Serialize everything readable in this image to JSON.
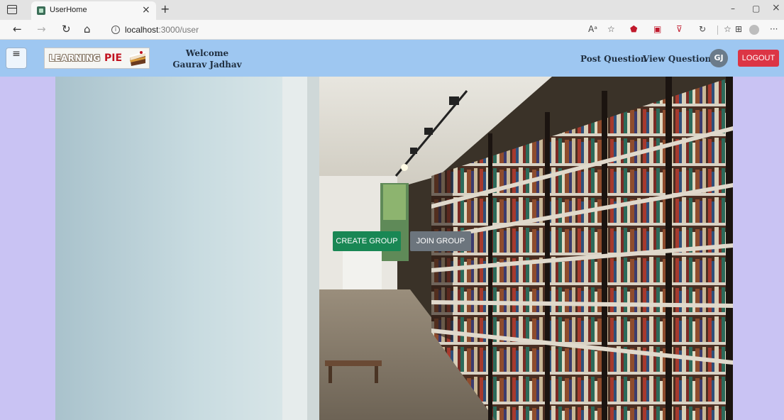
{
  "browser": {
    "tab_title": "UserHome",
    "tab_close": "×",
    "new_tab": "+",
    "url_host": "localhost",
    "url_path": ":3000/user",
    "window_controls": {
      "minimize": "–",
      "restore": "▢",
      "close": "×"
    },
    "nav": {
      "back": "←",
      "forward": "→",
      "reload": "↻",
      "home": "⌂",
      "info": "i"
    },
    "toolbar_icons": [
      "read-aloud-icon",
      "favorite-icon",
      "shield-extension-icon",
      "video-extension-icon",
      "pocket-extension-icon",
      "extensions-icon",
      "favorites-bar-icon",
      "collections-icon",
      "profile-icon",
      "more-icon"
    ]
  },
  "navbar": {
    "menu_icon": "≡",
    "logo": {
      "learning": "LEARNING",
      "pie": "PIE"
    },
    "welcome_label": "Welcome",
    "user_name": "Gaurav Jadhav",
    "links": {
      "post_question": "Post Question",
      "view_questions": "View Questions"
    },
    "avatar_initials": "GJ",
    "logout_label": "LOGOUT",
    "colors": {
      "bar": "#9ec7f1",
      "logout": "#dc3545",
      "avatar": "#6b7b8a"
    }
  },
  "hero": {
    "create_group_label": "CREATE GROUP",
    "join_group_label": "JOIN GROUP",
    "colors": {
      "create": "#198754",
      "join": "#6c757d",
      "page_bg": "#c9c3f3"
    }
  }
}
